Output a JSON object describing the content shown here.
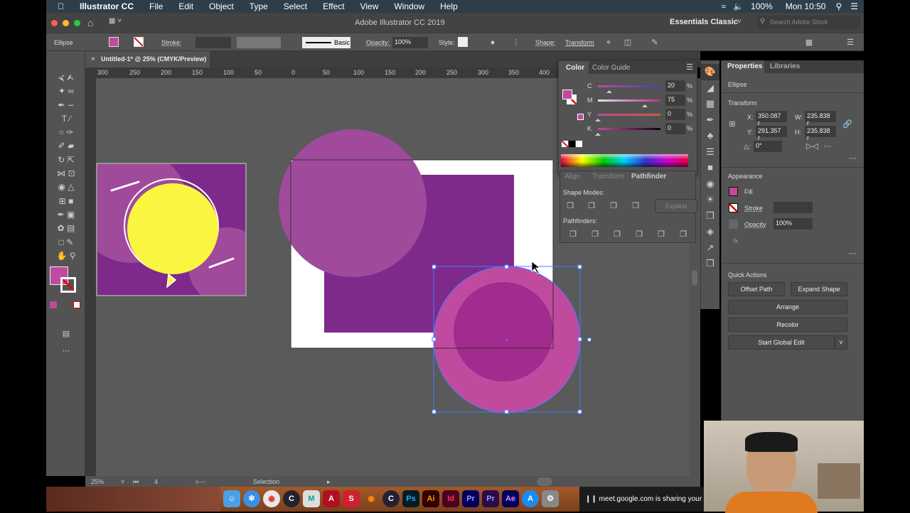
{
  "menubar": {
    "app": "Illustrator CC",
    "items": [
      "File",
      "Edit",
      "Object",
      "Type",
      "Select",
      "Effect",
      "View",
      "Window",
      "Help"
    ],
    "battery": "100%",
    "clock": "Mon 10:50"
  },
  "titlebar": {
    "title": "Adobe Illustrator CC 2019",
    "workspace": "Essentials Classic",
    "search_placeholder": "Search Adobe Stock"
  },
  "control": {
    "selection": "Ellipse",
    "stroke_label": "Stroke:",
    "brush": "Basic",
    "opacity_label": "Opacity:",
    "opacity": "100%",
    "style_label": "Style:",
    "shape_label": "Shape:",
    "transform_label": "Transform",
    "fill_color": "#c04a9e"
  },
  "document": {
    "tab": "Untitled-1* @ 25% (CMYK/Preview)",
    "ruler_ticks": [
      "300",
      "250",
      "200",
      "150",
      "100",
      "50",
      "0",
      "50",
      "100",
      "150",
      "200",
      "250",
      "300",
      "350",
      "400"
    ]
  },
  "color_panel": {
    "tabs": [
      "Color",
      "Color Guide"
    ],
    "channels": [
      {
        "label": "C",
        "value": "20",
        "unit": "%"
      },
      {
        "label": "M",
        "value": "75",
        "unit": "%"
      },
      {
        "label": "Y",
        "value": "0",
        "unit": "%"
      },
      {
        "label": "K",
        "value": "0",
        "unit": "%"
      }
    ]
  },
  "pathfinder": {
    "tabs": [
      "Align",
      "Transform",
      "Pathfinder"
    ],
    "shape_modes": "Shape Modes:",
    "expand": "Expand",
    "pathfinders": "Pathfinders:"
  },
  "properties": {
    "tabs": [
      "Properties",
      "Libraries"
    ],
    "object": "Ellipse",
    "transform": "Transform",
    "x_label": "X:",
    "x": "350.087 r",
    "y_label": "Y:",
    "y": "291.357 r",
    "w_label": "W:",
    "w": "235.838 r",
    "h_label": "H:",
    "h": "235.838 r",
    "angle": "0°",
    "appearance": "Appearance",
    "fill": "Fill",
    "stroke": "Stroke",
    "opacity_label": "Opacity",
    "opacity": "100%",
    "fx": "fx.",
    "quick_actions": "Quick Actions",
    "offset_path": "Offset Path",
    "expand_shape": "Expand Shape",
    "arrange": "Arrange",
    "recolor": "Recolor",
    "global_edit": "Start Global Edit"
  },
  "status": {
    "zoom": "25%",
    "artboard": "4",
    "tool": "Selection"
  },
  "dock": {
    "apps": [
      "Finder",
      "Safari",
      "Chrome",
      "Cinema 4D",
      "Maya",
      "Autocad",
      "SketchUp",
      "Blender",
      "Cinema 4D",
      "Ps",
      "Ai",
      "Id",
      "Pr",
      "Pr",
      "Ae",
      "App Store",
      "System Preferences"
    ]
  },
  "share": {
    "text": "meet.google.com is sharing your s"
  }
}
